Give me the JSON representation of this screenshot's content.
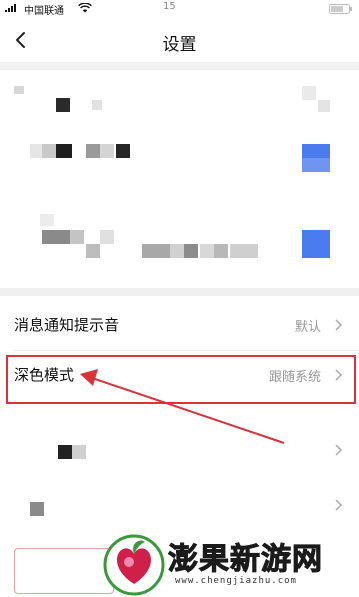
{
  "status_bar": {
    "carrier": "中国联通",
    "time": "15"
  },
  "nav": {
    "title": "设置"
  },
  "settings": {
    "notification_sound": {
      "label": "消息通知提示音",
      "value": "默认"
    },
    "dark_mode": {
      "label": "深色模式",
      "value": "跟随系统"
    }
  },
  "watermark": {
    "text": "澎果新游网",
    "url": "www.chengjiazhu.com"
  },
  "colors": {
    "annotation_red": "#d9323a",
    "obscured_blue": "#4a7cf0"
  }
}
